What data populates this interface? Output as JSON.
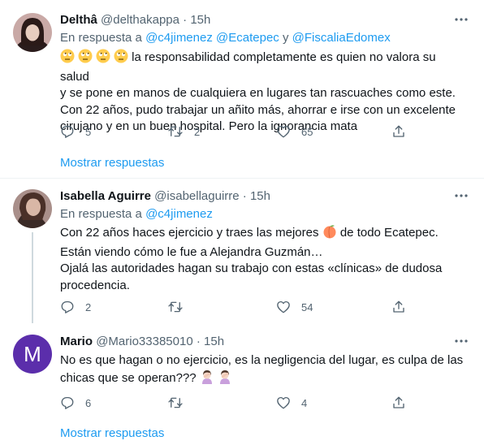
{
  "tweets": [
    {
      "display_name": "Delthâ",
      "handle": "@delthakappa",
      "dot": "·",
      "time": "15h",
      "reply_prefix": "En respuesta a",
      "mention_1": "@c4jimenez",
      "mention_2": "@Ecatepec",
      "conjunction": "y",
      "mention_3": "@FiscaliaEdomex",
      "emoji_name": "rolling-eyes",
      "text_line_1": "la responsabilidad completamente es quien no valora su salud",
      "text_line_2": "y se pone en manos de cualquiera en lugares tan rascuaches como este.",
      "text_line_3": "Con 22 años, pudo trabajar un añito más, ahorrar e irse con un excelente",
      "text_line_4": "cirujano y en un buen hospital. Pero la ignorancia mata",
      "reply_count": "5",
      "retweet_count": "2",
      "like_count": "65",
      "show_replies": "Mostrar respuestas"
    },
    {
      "display_name": "Isabella Aguirre",
      "handle": "@isabellaguirre",
      "dot": "·",
      "time": "15h",
      "reply_prefix": "En respuesta a",
      "mention_1": "@c4jimenez",
      "text_line_1a": "Con 22 años haces ejercicio y traes las mejores",
      "emoji_name": "peach",
      "text_line_1b": "de todo Ecatepec.",
      "text_line_2": "Están viendo cómo le fue a Alejandra Guzmán…",
      "text_line_3": "Ojalá las autoridades hagan su trabajo con estas «clínicas» de dudosa",
      "text_line_4": "procedencia.",
      "reply_count": "2",
      "retweet_count": "",
      "like_count": "54"
    },
    {
      "avatar_letter": "M",
      "display_name": "Mario",
      "handle": "@Mario33385010",
      "dot": "·",
      "time": "15h",
      "text_line_1": "No es que hagan o no ejercicio, es la negligencia del lugar, es culpa de las",
      "text_line_2": "chicas que se operan???",
      "emoji_name": "woman-facepalming",
      "reply_count": "6",
      "retweet_count": "",
      "like_count": "4",
      "show_replies": "Mostrar respuestas"
    }
  ],
  "colors": {
    "link": "#1d9bf0",
    "muted": "#536471",
    "text": "#0f1419",
    "separator": "#eff3f4",
    "avatar_mario": "#5b2eab"
  },
  "icons": [
    "reply-icon",
    "retweet-icon",
    "like-icon",
    "share-icon",
    "more-icon"
  ]
}
